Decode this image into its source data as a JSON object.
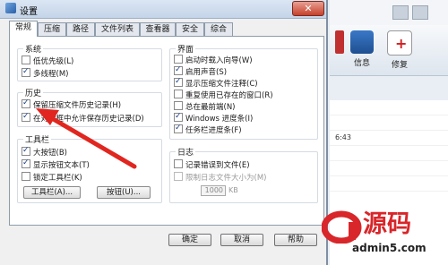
{
  "window": {
    "title": "设置",
    "close_label": "✕"
  },
  "tabs": [
    "常规",
    "压缩",
    "路径",
    "文件列表",
    "查看器",
    "安全",
    "综合"
  ],
  "system_group": {
    "title": "系统",
    "items": [
      {
        "label": "低优先级(L)",
        "checked": false
      },
      {
        "label": "多线程(M)",
        "checked": true
      }
    ]
  },
  "history_group": {
    "title": "历史",
    "items": [
      {
        "label": "保留压缩文件历史记录(H)",
        "checked": true
      },
      {
        "label": "在对话框中允许保存历史记录(D)",
        "checked": true
      }
    ]
  },
  "toolbar_group": {
    "title": "工具栏",
    "items": [
      {
        "label": "大按钮(B)",
        "checked": true
      },
      {
        "label": "显示按钮文本(T)",
        "checked": true
      },
      {
        "label": "锁定工具栏(K)",
        "checked": false
      }
    ],
    "toolbar_button": "工具栏(A)...",
    "buttons_button": "按钮(U)..."
  },
  "interface_group": {
    "title": "界面",
    "items": [
      {
        "label": "启动时载入向导(W)",
        "checked": false
      },
      {
        "label": "启用声音(S)",
        "checked": true
      },
      {
        "label": "显示压缩文件注释(C)",
        "checked": true
      },
      {
        "label": "重复使用已存在的窗口(R)",
        "checked": false
      },
      {
        "label": "总在最前端(N)",
        "checked": false
      },
      {
        "label": "Windows 进度条(I)",
        "checked": true
      },
      {
        "label": "任务栏进度条(F)",
        "checked": true
      }
    ]
  },
  "log_group": {
    "title": "日志",
    "items": [
      {
        "label": "记录错误到文件(E)",
        "checked": false
      },
      {
        "label": "限制日志文件大小为(M)",
        "checked": false,
        "disabled": true
      }
    ],
    "size_value": "1000",
    "size_unit": "KB"
  },
  "footer": {
    "ok": "确定",
    "cancel": "取消",
    "help": "帮助"
  },
  "background_app": {
    "tools": [
      {
        "label": "信息",
        "icon": "info-icon"
      },
      {
        "label": "修复",
        "icon": "repair-kit-icon"
      }
    ],
    "list_times": [
      "",
      "",
      "6:43",
      "",
      "",
      "",
      "",
      ""
    ]
  },
  "watermark": {
    "cn": "源码",
    "url": "admin5.com"
  },
  "colors": {
    "arrow": "#e0261f",
    "watermark": "#d8262a",
    "check": "#1b3f8a"
  }
}
